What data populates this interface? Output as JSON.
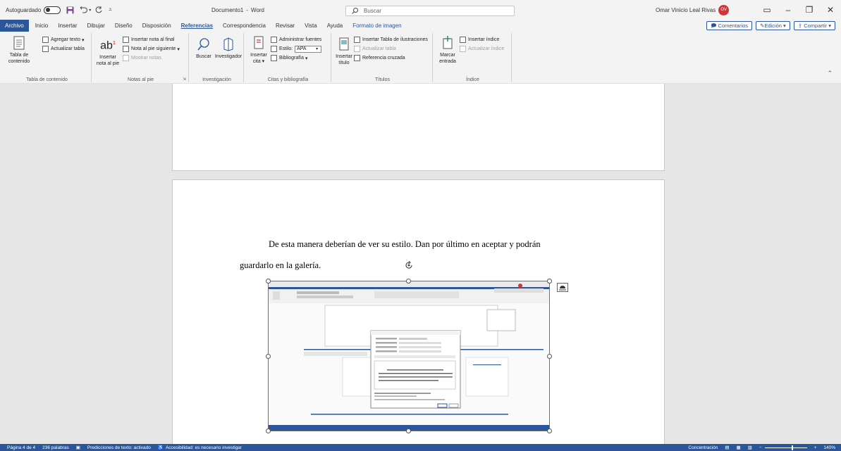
{
  "titlebar": {
    "autosave_label": "Autoguardado",
    "doc_title": "Documento1",
    "app_name": "Word",
    "separator": "-",
    "search_placeholder": "Buscar",
    "user_name": "Omar Vinicio Leal Rivas",
    "user_initials": "OV",
    "undo_icon": "undo-icon",
    "redo_icon": "redo-icon",
    "save_icon": "save-icon"
  },
  "menu": {
    "items": [
      "Archivo",
      "Inicio",
      "Insertar",
      "Dibujar",
      "Diseño",
      "Disposición",
      "Referencias",
      "Correspondencia",
      "Revisar",
      "Vista",
      "Ayuda",
      "Formato de imagen"
    ],
    "active": "Referencias"
  },
  "actions": {
    "comments": "Comentarios",
    "editing": "Edición",
    "share": "Compartir"
  },
  "ribbon": {
    "toc": {
      "label": "Tabla de contenido",
      "big_label_1": "Tabla de",
      "big_label_2": "contenido",
      "add_text": "Agregar texto",
      "update_table": "Actualizar tabla"
    },
    "footnotes": {
      "label": "Notas al pie",
      "insert_1": "Insertar",
      "insert_2": "nota al pie",
      "endnote": "Insertar nota al final",
      "next_footnote": "Nota al pie siguiente",
      "show_notes": "Mostrar notas"
    },
    "research": {
      "label": "Investigación",
      "search": "Buscar",
      "researcher": "Investigador"
    },
    "citations": {
      "label": "Citas y bibliografía",
      "insert_1": "Insertar",
      "insert_2": "cita",
      "manage_sources": "Administrar fuentes",
      "style_label": "Estilo:",
      "style_value": "APA",
      "bibliography": "Bibliografía"
    },
    "captions": {
      "label": "Títulos",
      "insert_1": "Insertar",
      "insert_2": "título",
      "insert_tof": "Insertar Tabla de ilustraciones",
      "update_table": "Actualizar tabla",
      "cross_ref": "Referencia cruzada"
    },
    "index": {
      "label": "Índice",
      "mark_1": "Marcar",
      "mark_2": "entrada",
      "insert_index": "Insertar índice",
      "update_index": "Actualizar índice"
    }
  },
  "document": {
    "line1": "De esta manera deberían de ver su estilo. Dan por último en aceptar y podrán",
    "line2": "guardarlo en la galería."
  },
  "status": {
    "page": "Página 4 de 4",
    "words": "236 palabras",
    "predictions": "Predicciones de texto: activado",
    "accessibility": "Accesibilidad: es necesario investigar",
    "focus": "Concentración",
    "zoom": "140%"
  }
}
